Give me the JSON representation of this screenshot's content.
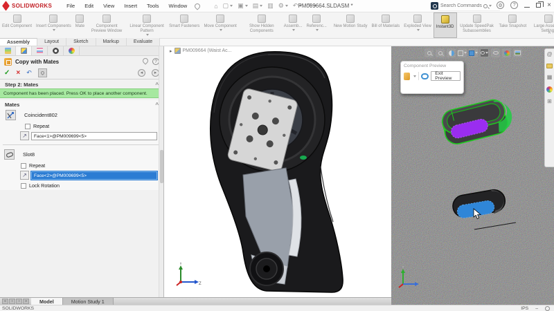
{
  "colors": {
    "logo_red": "#c22026",
    "selection_blue": "#2b7cd3",
    "message_green": "#a6e8a0",
    "preview_wire_green": "#1ecb1e",
    "highlight_purple": "#9a2df0",
    "face_highlight_blue": "#2f86d8"
  },
  "menubar": {
    "logo": "SOLIDWORKS",
    "items": [
      "File",
      "Edit",
      "View",
      "Insert",
      "Tools",
      "Window"
    ]
  },
  "titlebar": {
    "title": "PM009664.SLDASM *",
    "search_placeholder": "Search Commands"
  },
  "icons": {
    "home": "⌂",
    "new": "▢",
    "open": "▣",
    "save": "▤",
    "print": "▥",
    "settings": "⚙",
    "undo": "↶",
    "redo": "↷",
    "help": "?",
    "close": "×",
    "collapse": "^",
    "expand": "▸",
    "check": "✓",
    "cancel": "×",
    "nav_prev": "◂",
    "nav_next": "▸",
    "pick_arrow": "↗",
    "at": "@",
    "grid": "▦",
    "list": "⊞",
    "nav_first": "«",
    "nav_back": "‹",
    "nav_fwd": "›",
    "nav_last": "»",
    "dash": "–"
  },
  "ribbon": {
    "buttons": [
      "Edit Component",
      "Insert Components",
      "Mate",
      "Component Preview Window",
      "Linear Component Pattern",
      "Smart Fasteners",
      "Move Component",
      "Show Hidden Components",
      "Assemb...",
      "Referenc...",
      "New Motion Study",
      "Bill of Materials",
      "Exploded View",
      "Instant3D",
      "Update SpeedPak Subassemblies",
      "Take Snapshot",
      "Large Assembly Settings"
    ]
  },
  "doc_tabs": {
    "labels": [
      "Assembly",
      "Layout",
      "Sketch",
      "Markup",
      "Evaluate"
    ]
  },
  "panel": {
    "title": "Copy with Mates",
    "step_header": "Step 2: Mates",
    "message": "Component has been placed. Press OK to place another component.",
    "mates_header": "Mates",
    "coincident": {
      "name": "Coincident802",
      "repeat_label": "Repeat",
      "face": "Face<1>@PM009699<5>"
    },
    "slot": {
      "name": "Slot8",
      "repeat_label": "Repeat",
      "face": "Face<2>@PM009699<5>",
      "lock_label": "Lock Rotation"
    }
  },
  "viewport": {
    "model_label": "PM009664 (Waist Ac...",
    "axis_y": "Y",
    "axis_z": "Z"
  },
  "preview_popup": {
    "title": "Component Preview",
    "exit_label": "Exit Preview"
  },
  "bottom": {
    "tabs": [
      "Model",
      "Motion Study 1"
    ]
  },
  "status": {
    "left": "SOLIDWORKS",
    "units": "IPS"
  }
}
